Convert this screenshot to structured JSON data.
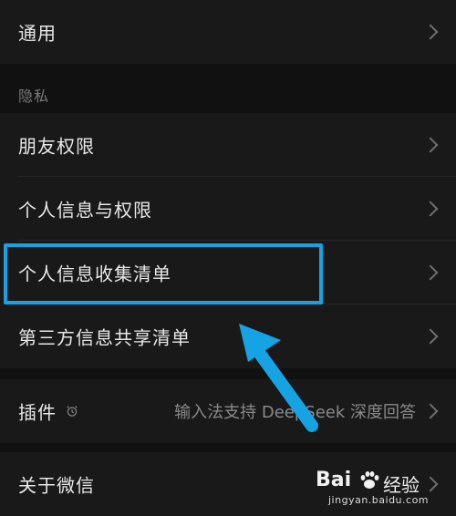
{
  "rows": {
    "general": "通用",
    "friend_permissions": "朋友权限",
    "personal_info_permissions": "个人信息与权限",
    "personal_info_collection": "个人信息收集清单",
    "third_party_sharing": "第三方信息共享清单",
    "plugins": "插件",
    "plugins_value": "输入法支持 DeepSeek 深度回答",
    "about": "关于微信"
  },
  "sections": {
    "privacy": "隐私"
  },
  "icons": {
    "chevron": "chevron-right-icon",
    "plugin_status": "alarm-clock-icon",
    "annotation_arrow": "arrow-up-left-icon"
  },
  "colors": {
    "background": "#111111",
    "row": "#191919",
    "highlight": "#16a3e4"
  },
  "watermark": {
    "brand": "Bai",
    "jingyan": "经验",
    "url": "jingyan.baidu.com"
  }
}
